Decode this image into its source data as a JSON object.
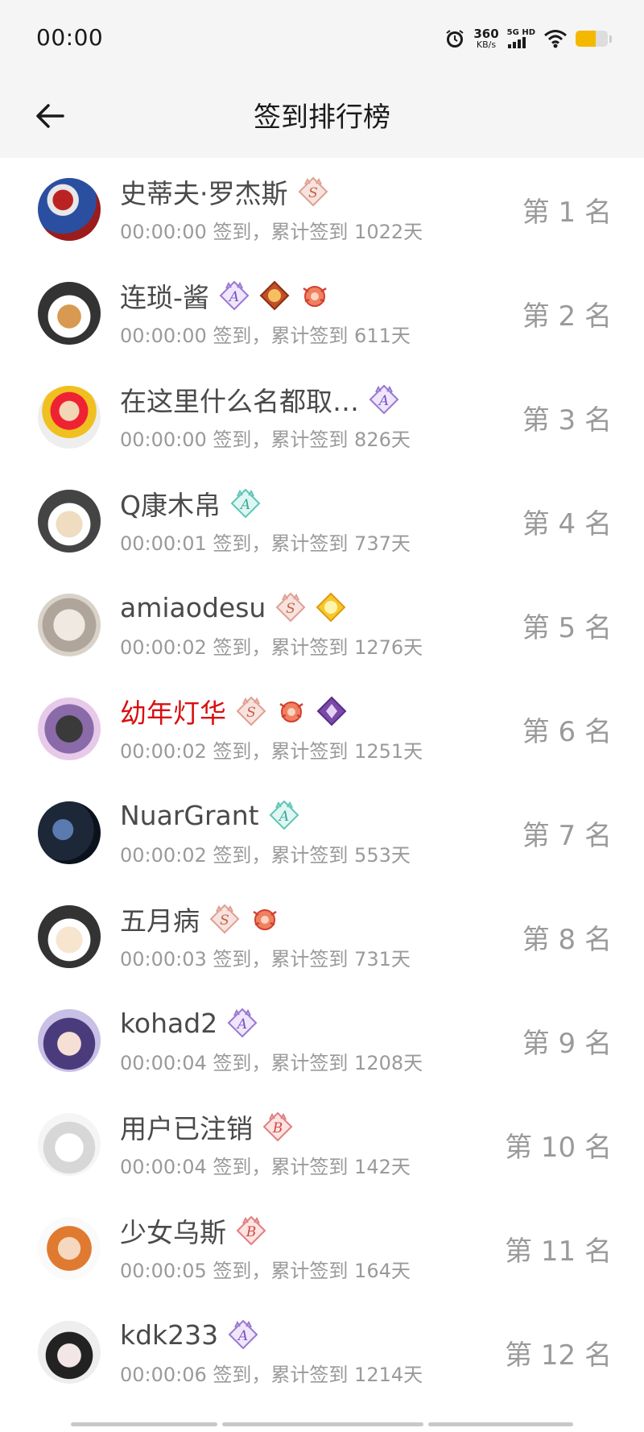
{
  "status_bar": {
    "time": "00:00",
    "speed_value": "360",
    "speed_unit": "KB/s",
    "net_label": "5G HD"
  },
  "header": {
    "title": "签到排行榜"
  },
  "rows": [
    {
      "name": "史蒂夫·罗杰斯",
      "sub": "00:00:00 签到，累计签到 1022天",
      "rank": "第 1 名",
      "badges": [
        "s"
      ]
    },
    {
      "name": "连琐-酱",
      "sub": "00:00:00 签到，累计签到 611天",
      "rank": "第 2 名",
      "badges": [
        "a-purple",
        "medal-orange",
        "crab-red"
      ]
    },
    {
      "name": "在这里什么名都取…",
      "sub": "00:00:00 签到，累计签到 826天",
      "rank": "第 3 名",
      "badges": [
        "a-purple"
      ]
    },
    {
      "name": "Q康木帛",
      "sub": "00:00:01 签到，累计签到 737天",
      "rank": "第 4 名",
      "badges": [
        "a-teal"
      ]
    },
    {
      "name": "amiaodesu",
      "sub": "00:00:02 签到，累计签到 1276天",
      "rank": "第 5 名",
      "badges": [
        "s",
        "gold"
      ]
    },
    {
      "name": "幼年灯华",
      "sub": "00:00:02 签到，累计签到 1251天",
      "rank": "第 6 名",
      "badges": [
        "s",
        "crab-red",
        "diamond-purple"
      ]
    },
    {
      "name": "NuarGrant",
      "sub": "00:00:02 签到，累计签到 553天",
      "rank": "第 7 名",
      "badges": [
        "a-teal"
      ]
    },
    {
      "name": "五月病",
      "sub": "00:00:03 签到，累计签到 731天",
      "rank": "第 8 名",
      "badges": [
        "s",
        "crab-red"
      ]
    },
    {
      "name": "kohad2",
      "sub": "00:00:04 签到，累计签到 1208天",
      "rank": "第 9 名",
      "badges": [
        "a-purple"
      ]
    },
    {
      "name": "用户已注销",
      "sub": "00:00:04 签到，累计签到 142天",
      "rank": "第 10 名",
      "badges": [
        "b"
      ]
    },
    {
      "name": "少女乌斯",
      "sub": "00:00:05 签到，累计签到 164天",
      "rank": "第 11 名",
      "badges": [
        "b"
      ]
    },
    {
      "name": "kdk233",
      "sub": "00:00:06 签到，累计签到 1214天",
      "rank": "第 12 名",
      "badges": [
        "a-purple"
      ]
    }
  ],
  "badge_legend": {
    "s": "s-level-icon",
    "a-purple": "a-level-purple-icon",
    "a-teal": "a-level-teal-icon",
    "b": "b-level-icon",
    "gold": "gold-medal-icon",
    "crab-red": "red-crab-medal-icon",
    "medal-orange": "orange-medal-icon",
    "diamond-purple": "purple-diamond-icon"
  },
  "colors": {
    "highlight_name": "#d81010",
    "text_secondary": "#9a9a9a",
    "header_bg": "#f5f5f5"
  }
}
